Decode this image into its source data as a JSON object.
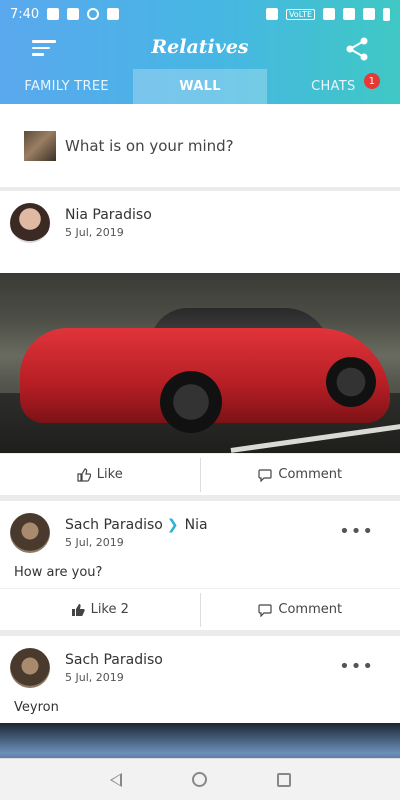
{
  "status_bar": {
    "time": "7:40",
    "network_tag": "VoLTE"
  },
  "app": {
    "title": "Relatives"
  },
  "tabs": [
    {
      "label": "FAMILY TREE"
    },
    {
      "label": "WALL"
    },
    {
      "label": "CHATS"
    }
  ],
  "chats_badge": "1",
  "composer": {
    "placeholder": "What is on your mind?"
  },
  "posts": [
    {
      "author": "Nia Paradiso",
      "date": "5 Jul, 2019",
      "image": "red-sports-car",
      "like_label": "Like",
      "comment_label": "Comment"
    },
    {
      "author": "Sach Paradiso",
      "recipient": "Nia",
      "date": "5 Jul, 2019",
      "text": "How are you?",
      "like_label": "Like 2",
      "comment_label": "Comment"
    },
    {
      "author": "Sach Paradiso",
      "date": "5 Jul, 2019",
      "text": "Veyron",
      "image": "veyron-car"
    }
  ],
  "colors": {
    "accent": "#2bb3d9",
    "badge": "#e53935",
    "gradient_start": "#5aa8ee",
    "gradient_end": "#3fc8c4"
  },
  "icons": {
    "menu": "menu-icon",
    "share": "share-icon",
    "like": "thumbs-up-icon",
    "comment": "comment-icon",
    "more": "more-icon"
  }
}
